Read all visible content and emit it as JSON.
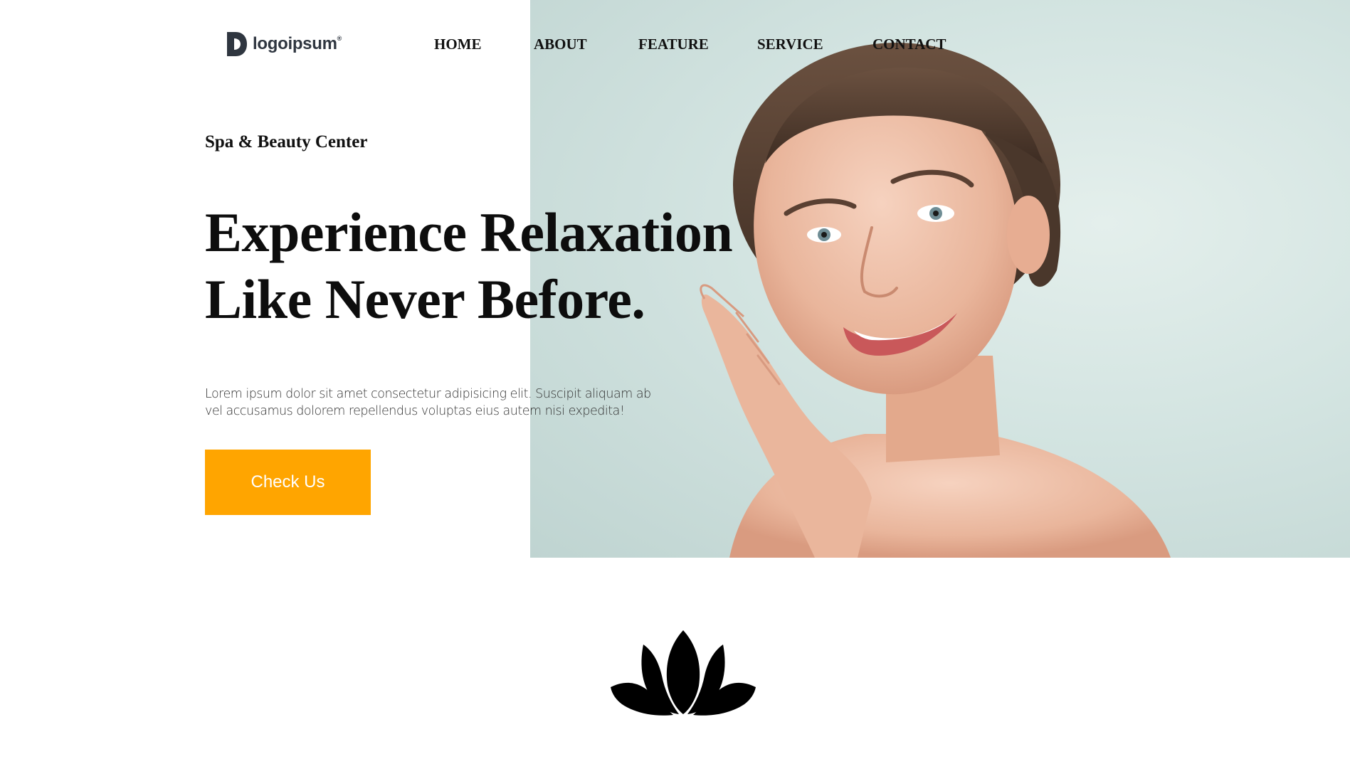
{
  "brand": {
    "logo_text": "logoipsum",
    "logo_trademark": "®"
  },
  "nav": {
    "items": [
      {
        "label": "HOME"
      },
      {
        "label": "ABOUT"
      },
      {
        "label": "FEATURE"
      },
      {
        "label": "SERVICE"
      },
      {
        "label": "CONTACT"
      }
    ]
  },
  "hero": {
    "subtitle": "Spa & Beauty Center",
    "headline_line1": "Experience Relaxation",
    "headline_line2": "Like Never Before.",
    "description": "Lorem ipsum dolor sit amet consectetur adipisicing elit. Suscipit aliquam ab vel accusamus dolorem repellendus voluptas eius autem nisi expedita!",
    "cta_label": "Check Us",
    "image_icon": "woman-portrait-image"
  },
  "section": {
    "icon": "lotus-icon"
  },
  "colors": {
    "accent": "#ffa500",
    "text": "#111111",
    "image_bg": "#d3e4e1",
    "background": "#ffffff"
  }
}
